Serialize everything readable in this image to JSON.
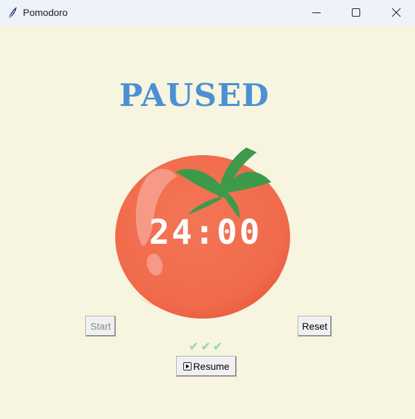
{
  "window": {
    "title": "Pomodoro",
    "icons": {
      "app": "feather-icon",
      "minimize": "minimize-icon",
      "maximize": "maximize-icon",
      "close": "close-icon"
    }
  },
  "status": {
    "label": "PAUSED",
    "color": "#4a90d4"
  },
  "timer": {
    "display": "24:00"
  },
  "controls": {
    "start_label": "Start",
    "reset_label": "Reset",
    "resume_label": "Resume",
    "resume_icon": "play-icon"
  },
  "checkmarks": {
    "text": "✔✔✔",
    "count": 3,
    "color": "#8fd6a3"
  },
  "colors": {
    "background": "#f7f4df",
    "tomato": "#f06c4f",
    "leaves": "#3d9a4a"
  }
}
